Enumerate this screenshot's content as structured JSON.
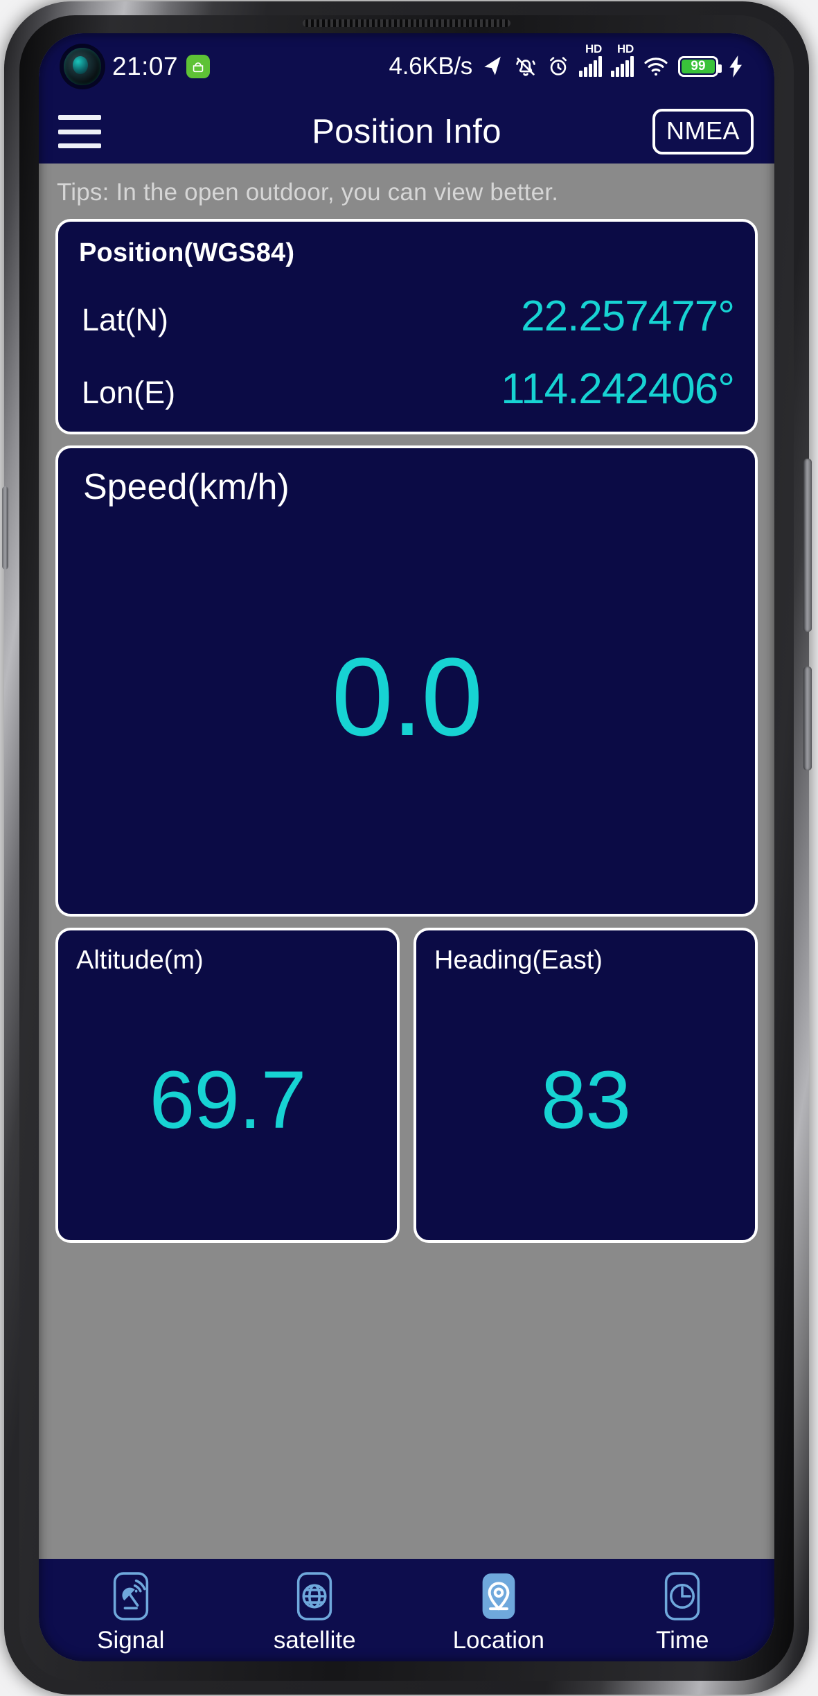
{
  "status_bar": {
    "time": "21:07",
    "android_badge_icon": "android-robot-icon",
    "net_speed": "4.6KB/s",
    "icons": [
      "location-arrow-icon",
      "bell-muted-icon",
      "alarm-clock-icon",
      "hd-signal-1-icon",
      "hd-signal-2-icon",
      "wifi-icon"
    ],
    "battery_level": "99",
    "battery_color": "#39c23a",
    "charging_icon": "lightning-bolt-icon"
  },
  "header": {
    "menu_icon": "hamburger-menu-icon",
    "title": "Position Info",
    "nmea_label": "NMEA"
  },
  "tips": {
    "text": "Tips: In the open outdoor, you can view better."
  },
  "position_card": {
    "title": "Position(WGS84)",
    "lat_label": "Lat(N)",
    "lat_value": "22.257477°",
    "lon_label": "Lon(E)",
    "lon_value": "114.242406°"
  },
  "speed_card": {
    "title": "Speed(km/h)",
    "value": "0.0"
  },
  "altitude_card": {
    "title": "Altitude(m)",
    "value": "69.7"
  },
  "heading_card": {
    "title": "Heading(East)",
    "value": "83"
  },
  "bottom_nav": {
    "items": [
      {
        "label": "Signal",
        "icon": "satellite-dish-icon",
        "active": false
      },
      {
        "label": "satellite",
        "icon": "globe-icon",
        "active": false
      },
      {
        "label": "Location",
        "icon": "map-pin-icon",
        "active": true
      },
      {
        "label": "Time",
        "icon": "clock-icon",
        "active": false
      }
    ]
  },
  "theme": {
    "app_bg": "#0d0d4d",
    "card_bg": "#0b0b45",
    "accent": "#17d3d3",
    "page_bg": "#8a8a8a"
  }
}
